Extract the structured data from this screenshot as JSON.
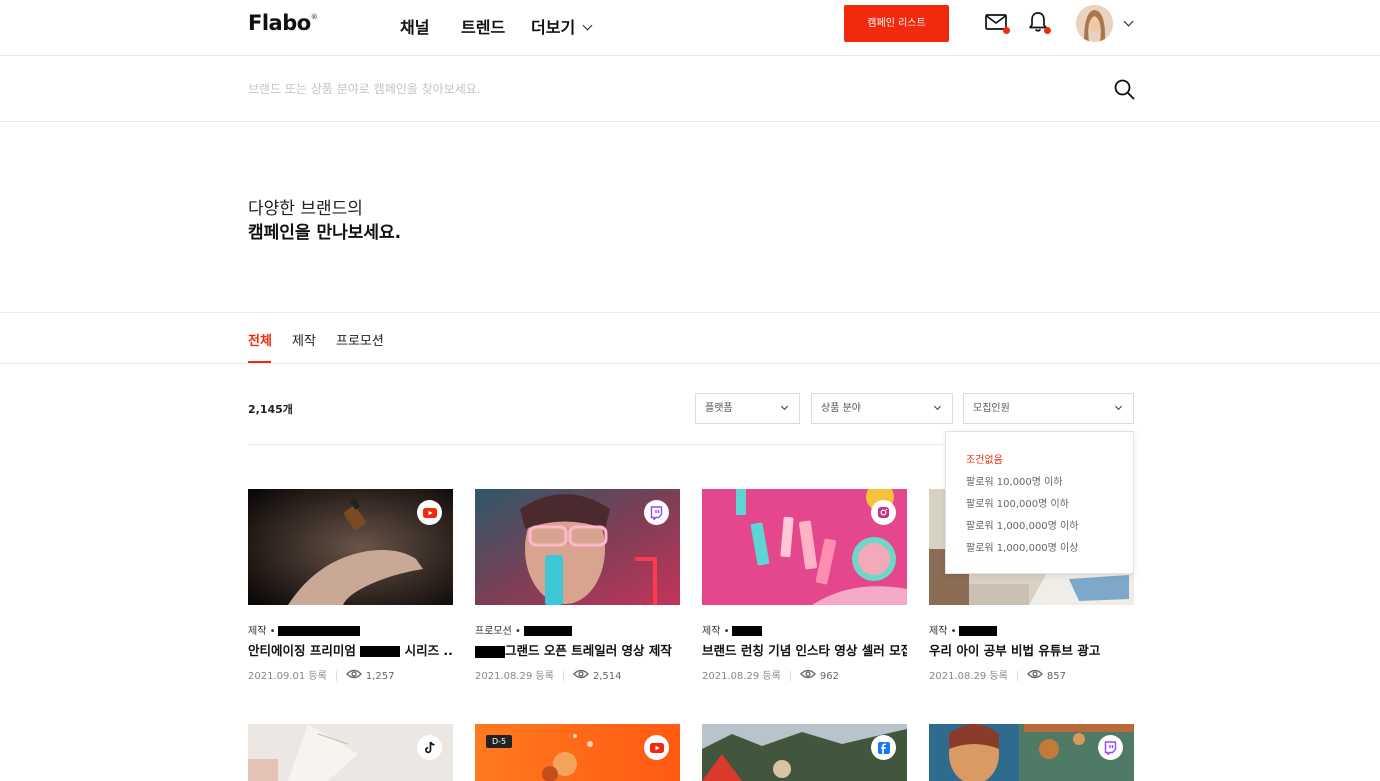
{
  "header": {
    "logo": "Flabo",
    "logo_mark": "®",
    "nav": [
      "채널",
      "트렌드",
      "더보기"
    ],
    "campaign_button": "캠페인 리스트",
    "accent": "#f2290d"
  },
  "search": {
    "placeholder": "브랜드 또는 상품 분야로 캠페인을 찾아보세요."
  },
  "hero": {
    "line1": "다양한 브랜드의",
    "line2": "캠페인을 만나보세요."
  },
  "tabs": [
    "전체",
    "제작",
    "프로모션"
  ],
  "active_tab": "전체",
  "count": "2,145개",
  "filters": {
    "platform": "플랫폼",
    "category": "상품 분야",
    "recruit": "모집인원"
  },
  "recruit_options": [
    "조건없음",
    "팔로워 10,000명 이하",
    "팔로워 100,000명 이하",
    "팔로워 1,000,000명 이하",
    "팔로워 1,000,000명 이상"
  ],
  "selected_recruit": "조건없음",
  "cards": [
    {
      "category": "제작 •",
      "title": "안티에이징 프리미엄 ",
      "title_end": " 시리즈 ...",
      "date": "2021.09.01 등록",
      "views": "1,257",
      "platform": "youtube-icon"
    },
    {
      "category": "프로모션 •",
      "title": "",
      "title_end": "그랜드 오픈 트레일러 영상 제작",
      "date": "2021.08.29 등록",
      "views": "2,514",
      "platform": "twitch-icon"
    },
    {
      "category": "제작 •",
      "title": "브랜드 런칭 기념 인스타 영상 셀러 모집",
      "title_end": "",
      "date": "2021.08.29 등록",
      "views": "962",
      "platform": "instagram-icon"
    },
    {
      "category": "제작 •",
      "title": "우리 아이 공부 비법 유튜브 광고",
      "title_end": "",
      "date": "2021.08.29 등록",
      "views": "857",
      "platform": "twitch-icon"
    }
  ],
  "row2": [
    {
      "platform": "tiktok-icon",
      "badge": ""
    },
    {
      "platform": "youtube-icon",
      "badge": "D-5"
    },
    {
      "platform": "facebook-icon",
      "badge": ""
    },
    {
      "platform": "twitch-icon",
      "badge": ""
    }
  ]
}
